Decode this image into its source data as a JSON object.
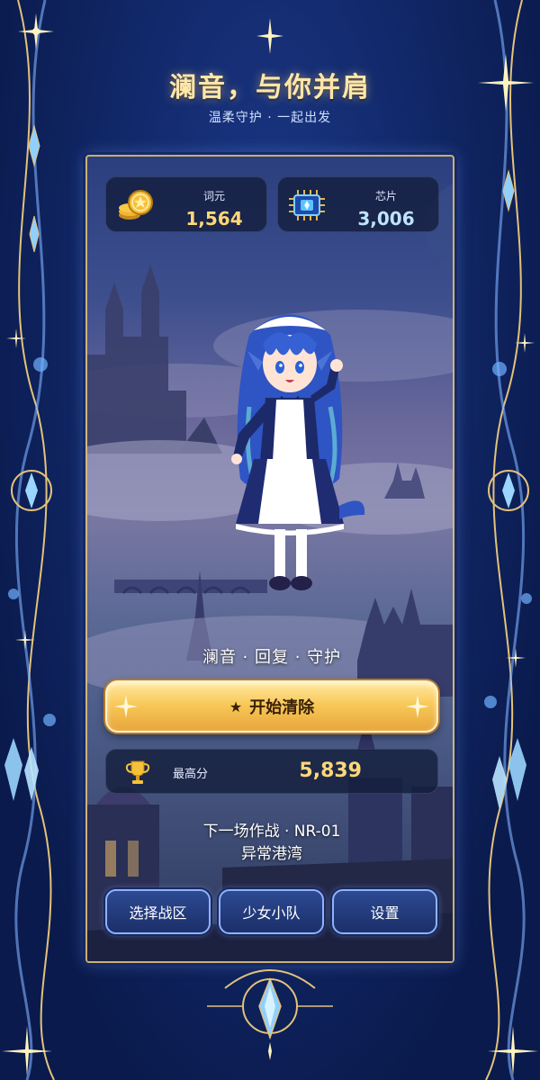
{
  "header": {
    "title": "澜音，与你并肩",
    "subtitle": "温柔守护 · 一起出发"
  },
  "currencies": [
    {
      "label": "词元",
      "value": "1,564",
      "icon": "gold-coins-icon"
    },
    {
      "label": "芯片",
      "value": "3,006",
      "icon": "chip-icon"
    }
  ],
  "character": {
    "tagline": "澜音 · 回复 · 守护"
  },
  "start_button": {
    "star": "★",
    "label": "开始清除"
  },
  "best_score": {
    "label": "最高分",
    "value": "5,839",
    "icon": "trophy-icon"
  },
  "next_battle": {
    "line1": "下一场作战 · NR-01",
    "line2": "异常港湾"
  },
  "bottom_menu": {
    "select_zone": "选择战区",
    "squad": "少女小队",
    "settings": "设置"
  },
  "colors": {
    "frame_navy": "#0b1a4a",
    "gold": "#ffd778",
    "accent_blue": "#8fb2ff",
    "button_gold": "#f8c95a"
  }
}
